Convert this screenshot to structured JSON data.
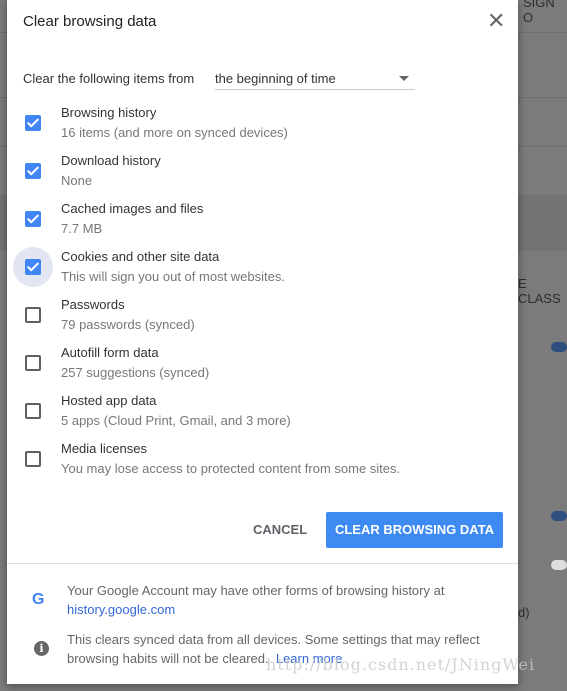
{
  "background": {
    "fragments": [
      "SIGN O",
      "E CLASS",
      "d)"
    ]
  },
  "dialog": {
    "title": "Clear browsing data",
    "close_icon": "close-icon",
    "from_label": "Clear the following items from",
    "time_range": "the beginning of time",
    "items": [
      {
        "label": "Browsing history",
        "sub": "16 items (and more on synced devices)",
        "checked": true
      },
      {
        "label": "Download history",
        "sub": "None",
        "checked": true
      },
      {
        "label": "Cached images and files",
        "sub": "7.7 MB",
        "checked": true
      },
      {
        "label": "Cookies and other site data",
        "sub": "This will sign you out of most websites.",
        "checked": true,
        "focused": true
      },
      {
        "label": "Passwords",
        "sub": "79 passwords (synced)",
        "checked": false
      },
      {
        "label": "Autofill form data",
        "sub": "257 suggestions (synced)",
        "checked": false
      },
      {
        "label": "Hosted app data",
        "sub": "5 apps (Cloud Print, Gmail, and 3 more)",
        "checked": false
      },
      {
        "label": "Media licenses",
        "sub": "You may lose access to protected content from some sites.",
        "checked": false
      }
    ],
    "cancel_label": "CANCEL",
    "clear_label": "CLEAR BROWSING DATA",
    "accent": "#3d8af2",
    "footer": {
      "google_text": "Your Google Account may have other forms of browsing history at",
      "google_link": "history.google.com",
      "sync_text": "This clears synced data from all devices. Some settings that may reflect browsing habits will not be cleared.",
      "learn_more": "Learn more"
    }
  },
  "watermark": "http://blog.csdn.net/JNingWei"
}
